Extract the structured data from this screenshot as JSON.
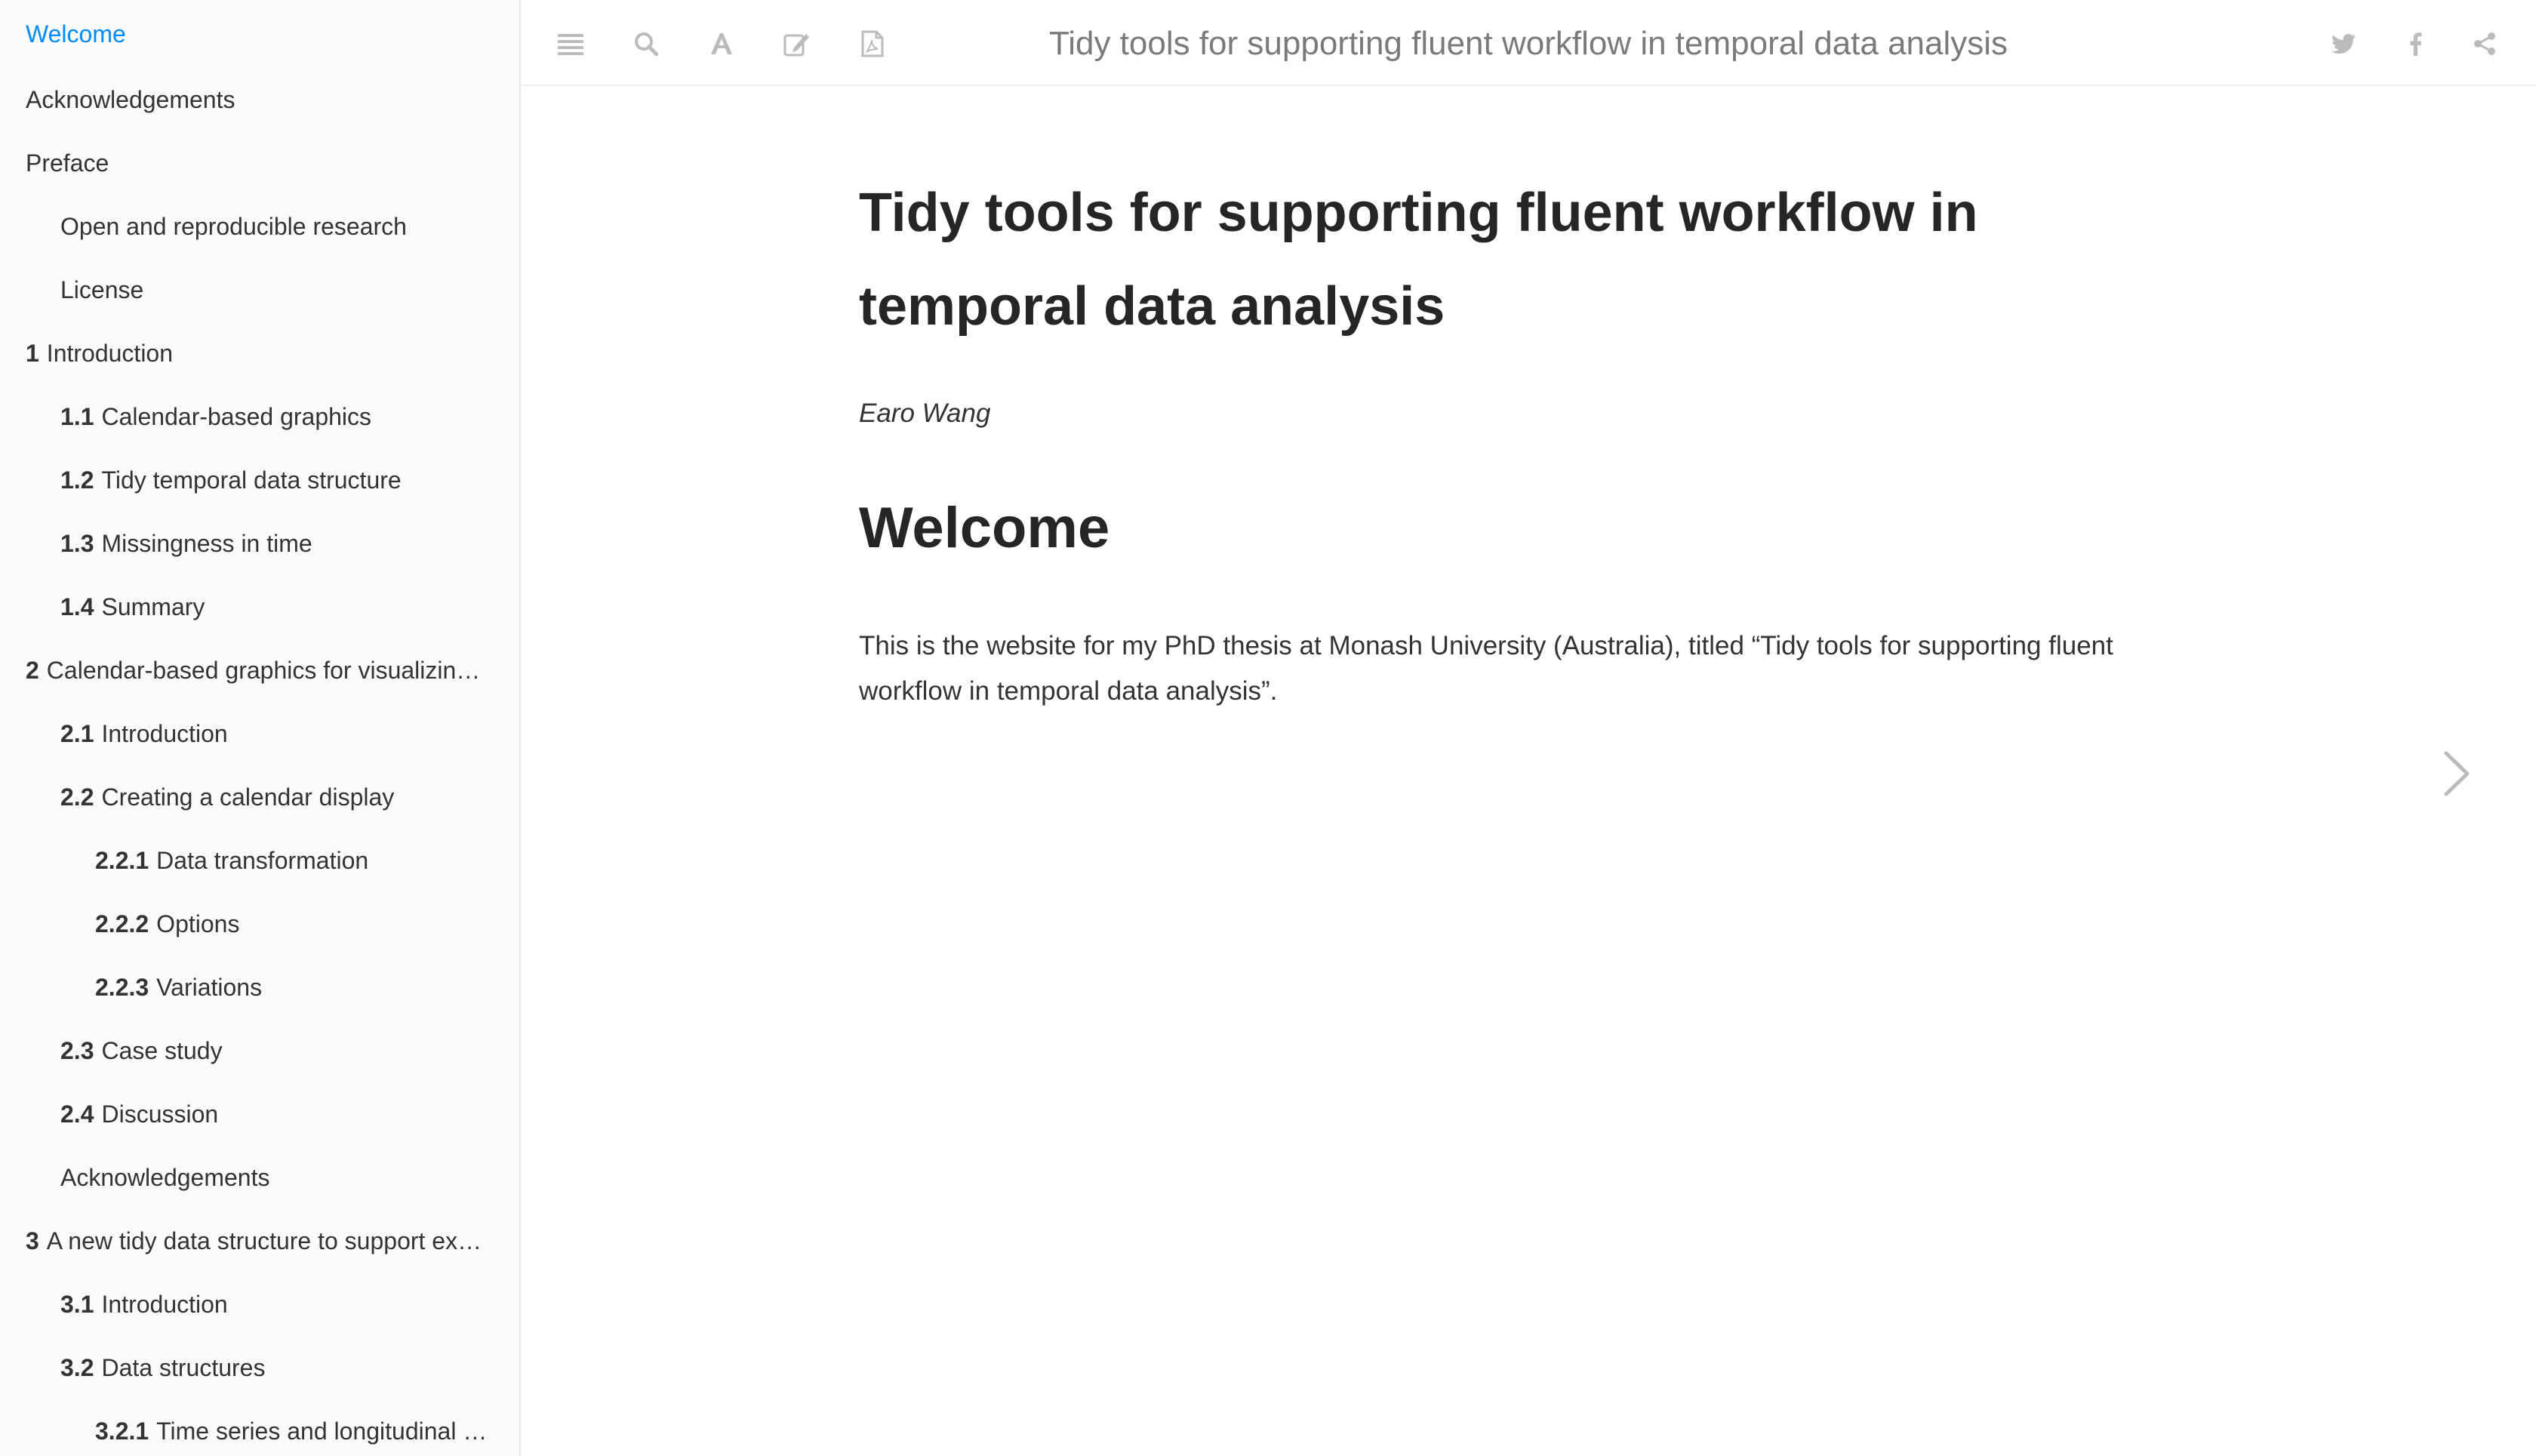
{
  "sidebar": {
    "items": [
      {
        "num": "",
        "label": "Welcome",
        "level": 0,
        "active": true
      },
      {
        "num": "",
        "label": "Acknowledgements",
        "level": 0,
        "active": false
      },
      {
        "num": "",
        "label": "Preface",
        "level": 0,
        "active": false
      },
      {
        "num": "",
        "label": "Open and reproducible research",
        "level": 1,
        "active": false
      },
      {
        "num": "",
        "label": "License",
        "level": 1,
        "active": false
      },
      {
        "num": "1",
        "label": "Introduction",
        "level": 0,
        "active": false
      },
      {
        "num": "1.1",
        "label": "Calendar-based graphics",
        "level": 1,
        "active": false
      },
      {
        "num": "1.2",
        "label": "Tidy temporal data structure",
        "level": 1,
        "active": false
      },
      {
        "num": "1.3",
        "label": "Missingness in time",
        "level": 1,
        "active": false
      },
      {
        "num": "1.4",
        "label": "Summary",
        "level": 1,
        "active": false
      },
      {
        "num": "2",
        "label": "Calendar-based graphics for visualizing people’s daily schedules",
        "level": 0,
        "active": false
      },
      {
        "num": "2.1",
        "label": "Introduction",
        "level": 1,
        "active": false
      },
      {
        "num": "2.2",
        "label": "Creating a calendar display",
        "level": 1,
        "active": false
      },
      {
        "num": "2.2.1",
        "label": "Data transformation",
        "level": 2,
        "active": false
      },
      {
        "num": "2.2.2",
        "label": "Options",
        "level": 2,
        "active": false
      },
      {
        "num": "2.2.3",
        "label": "Variations",
        "level": 2,
        "active": false
      },
      {
        "num": "2.3",
        "label": "Case study",
        "level": 1,
        "active": false
      },
      {
        "num": "2.4",
        "label": "Discussion",
        "level": 1,
        "active": false
      },
      {
        "num": "",
        "label": "Acknowledgements",
        "level": 1,
        "active": false
      },
      {
        "num": "3",
        "label": "A new tidy data structure to support exploration and modeling of temporal data",
        "level": 0,
        "active": false
      },
      {
        "num": "3.1",
        "label": "Introduction",
        "level": 1,
        "active": false
      },
      {
        "num": "3.2",
        "label": "Data structures",
        "level": 1,
        "active": false
      },
      {
        "num": "3.2.1",
        "label": "Time series and longitudinal data",
        "level": 2,
        "active": false
      }
    ]
  },
  "toolbar": {
    "book_title": "Tidy tools for supporting fluent workflow in temporal data analysis",
    "left_icons": [
      "menu-icon",
      "search-icon",
      "font-settings-icon",
      "edit-icon",
      "pdf-download-icon"
    ],
    "right_icons": [
      "twitter-icon",
      "facebook-icon",
      "share-icon"
    ]
  },
  "main": {
    "title": "Tidy tools for supporting fluent workflow in temporal data analysis",
    "author": "Earo Wang",
    "section_heading": "Welcome",
    "body": "This is the website for my PhD thesis at Monash University (Australia), titled “Tidy tools for supporting fluent workflow in temporal data analysis”."
  },
  "navigation": {
    "next_icon": "chevron-right-icon"
  },
  "colors": {
    "accent": "#008cff",
    "icon": "#bbbbbb",
    "sidebar_bg": "#fafafa",
    "text": "#333333"
  }
}
